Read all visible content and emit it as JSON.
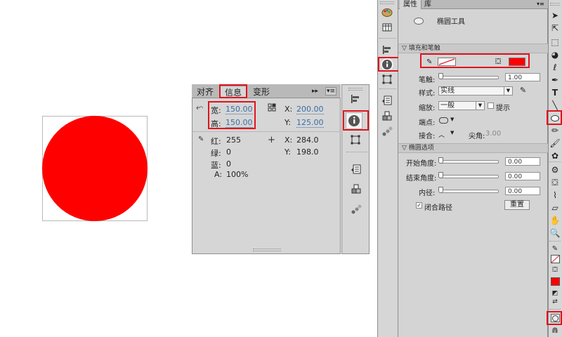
{
  "canvas": {
    "shape_color": "#ff0000"
  },
  "info_panel": {
    "tabs": [
      {
        "label": "对齐"
      },
      {
        "label": "信息"
      },
      {
        "label": "变形"
      }
    ],
    "collapse_label": "▸▸",
    "menu_label": "▾≡",
    "width_label": "宽:",
    "width_value": "150.00",
    "height_label": "高:",
    "height_value": "150.00",
    "x1_label": "X:",
    "x1_value": "200.00",
    "y1_label": "Y:",
    "y1_value": "125.00",
    "red_label": "红:",
    "red_value": "255",
    "green_label": "绿:",
    "green_value": "0",
    "blue_label": "蓝:",
    "blue_value": "0",
    "alpha_label": "A:",
    "alpha_value": "100%",
    "x2_label": "X:",
    "x2_value": "284.0",
    "y2_label": "Y:",
    "y2_value": "198.0"
  },
  "properties_panel": {
    "tabs": [
      {
        "label": "属性"
      },
      {
        "label": "库"
      }
    ],
    "tool_name": "椭圆工具",
    "fill_stroke_section": "填充和笔触",
    "stroke_label": "笔触:",
    "stroke_value": "1.00",
    "style_label": "样式:",
    "style_value": "实线",
    "scale_label": "缩放:",
    "scale_value": "一般",
    "hint_label": "提示",
    "cap_label": "端点:",
    "join_label": "接合:",
    "miter_label": "尖角:",
    "miter_value": "3.00",
    "oval_section": "椭圆选项",
    "start_angle_label": "开始角度:",
    "start_angle_value": "0.00",
    "end_angle_label": "结束角度:",
    "end_angle_value": "0.00",
    "inner_radius_label": "内径:",
    "inner_radius_value": "0.00",
    "close_path_label": "闭合路径",
    "reset_label": "重置",
    "fill_color": "#ff0000",
    "stroke_color": "none"
  },
  "toolbar": {
    "tools": [
      "selection-arrow",
      "subselection-arrow",
      "free-transform",
      "3d-rotation",
      "lasso",
      "pen",
      "text",
      "line",
      "oval",
      "pencil",
      "brush",
      "deco",
      "bone",
      "paint-bucket",
      "eyedropper",
      "eraser",
      "hand",
      "zoom"
    ],
    "stroke_color": "none",
    "fill_color": "#ff0000"
  }
}
